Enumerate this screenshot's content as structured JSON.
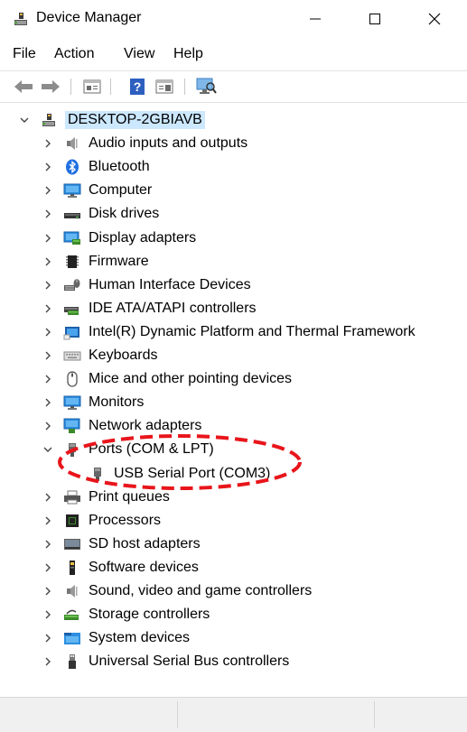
{
  "window": {
    "title": "Device Manager",
    "minimize": "—",
    "maximize": "☐",
    "close": "✕"
  },
  "menu": [
    "File",
    "Action",
    "View",
    "Help"
  ],
  "toolbar": [
    "back-icon",
    "forward-icon",
    "properties-icon",
    "help-icon",
    "show-hidden-icon",
    "scan-hardware-icon"
  ],
  "tree": {
    "root": {
      "label": "DESKTOP-2GBIAVB",
      "expanded": true,
      "selected": true
    },
    "categories": [
      {
        "label": "Audio inputs and outputs",
        "icon": "speaker-icon",
        "expanded": false
      },
      {
        "label": "Bluetooth",
        "icon": "bluetooth-icon",
        "expanded": false
      },
      {
        "label": "Computer",
        "icon": "monitor-icon",
        "expanded": false
      },
      {
        "label": "Disk drives",
        "icon": "disk-drive-icon",
        "expanded": false
      },
      {
        "label": "Display adapters",
        "icon": "display-adapter-icon",
        "expanded": false
      },
      {
        "label": "Firmware",
        "icon": "firmware-chip-icon",
        "expanded": false
      },
      {
        "label": "Human Interface Devices",
        "icon": "hid-icon",
        "expanded": false
      },
      {
        "label": "IDE ATA/ATAPI controllers",
        "icon": "ide-controller-icon",
        "expanded": false
      },
      {
        "label": "Intel(R) Dynamic Platform and Thermal Framework",
        "icon": "platform-icon",
        "expanded": false
      },
      {
        "label": "Keyboards",
        "icon": "keyboard-icon",
        "expanded": false
      },
      {
        "label": "Mice and other pointing devices",
        "icon": "mouse-icon",
        "expanded": false
      },
      {
        "label": "Monitors",
        "icon": "monitor-icon",
        "expanded": false
      },
      {
        "label": "Network adapters",
        "icon": "network-adapter-icon",
        "expanded": false
      },
      {
        "label": "Ports (COM & LPT)",
        "icon": "port-icon",
        "expanded": true,
        "children": [
          {
            "label": "USB Serial Port (COM3)",
            "icon": "port-icon"
          }
        ]
      },
      {
        "label": "Print queues",
        "icon": "printer-icon",
        "expanded": false
      },
      {
        "label": "Processors",
        "icon": "processor-icon",
        "expanded": false
      },
      {
        "label": "SD host adapters",
        "icon": "sd-host-icon",
        "expanded": false
      },
      {
        "label": "Software devices",
        "icon": "software-device-icon",
        "expanded": false
      },
      {
        "label": "Sound, video and game controllers",
        "icon": "speaker-icon",
        "expanded": false
      },
      {
        "label": "Storage controllers",
        "icon": "storage-controller-icon",
        "expanded": false
      },
      {
        "label": "System devices",
        "icon": "system-folder-icon",
        "expanded": false
      },
      {
        "label": "Universal Serial Bus controllers",
        "icon": "usb-icon",
        "expanded": false
      }
    ]
  },
  "colors": {
    "selection": "#cce8ff",
    "annotation": "#e8151b",
    "accent": "#0078d7"
  },
  "annotation": {
    "shape": "dashed-ellipse",
    "target": "USB Serial Port (COM3)"
  }
}
